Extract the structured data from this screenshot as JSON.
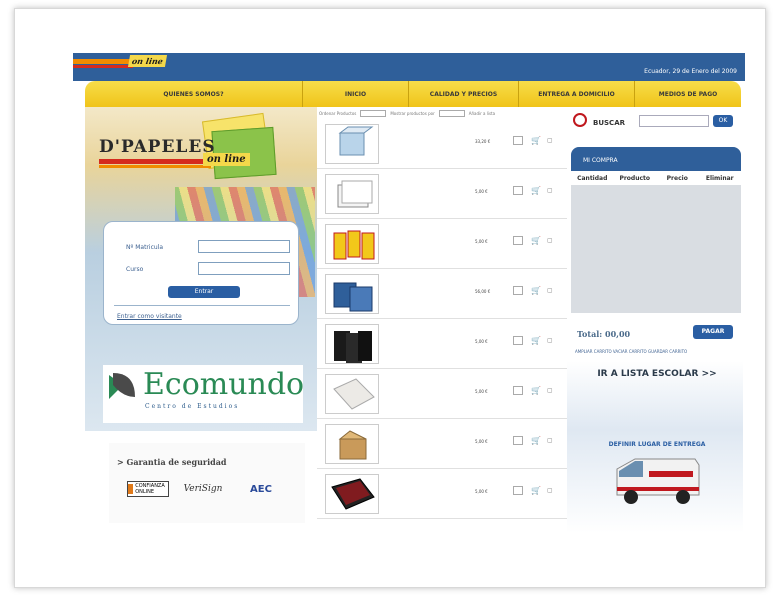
{
  "header": {
    "logo_text": "on line",
    "date": "Ecuador, 29 de Enero del 2009"
  },
  "nav": [
    "QUIENES SOMOS?",
    "INICIO",
    "CALIDAD Y PRECIOS",
    "ENTREGA A DOMICILIO",
    "MEDIOS DE PAGO"
  ],
  "brand": {
    "name": "D'PAPELES",
    "online": "on line"
  },
  "login": {
    "matricula_label": "Nº Matricula",
    "curso_label": "Curso",
    "enter_button": "Entrar",
    "visitor_link": "Entrar como visitante"
  },
  "ecomundo": {
    "name": "Ecomundo",
    "subtitle": "Centro de Estudios"
  },
  "security": {
    "title": "> Garantia de seguridad",
    "badges": [
      "CONFIANZA ONLINE",
      "VeriSign",
      "AEC"
    ]
  },
  "toolbar": {
    "sort": "Ordenar Productos",
    "show": "Mostrar productos por",
    "add": "Añadir a lista"
  },
  "products": [
    {
      "price": "33,20 €"
    },
    {
      "price": "5,00 €"
    },
    {
      "price": "5,00 €"
    },
    {
      "price": "56,00 €"
    },
    {
      "price": "5,00 €"
    },
    {
      "price": "5,00 €"
    },
    {
      "price": "5,00 €"
    },
    {
      "price": "5,00 €"
    }
  ],
  "search": {
    "label": "BUSCAR",
    "button": "OK"
  },
  "cart": {
    "title": "MI COMPRA",
    "columns": [
      "Cantidad",
      "Producto",
      "Precio",
      "Eliminar"
    ],
    "total": "Total: 00,00",
    "pay_button": "PAGAR",
    "links": "AMPLIAR CARRITO  VACIAR CARRITO  GUARDAR CARRITO"
  },
  "lista_escolar": "IR A LISTA ESCOLAR >>",
  "entrega": "DEFINIR LUGAR DE ENTREGA",
  "colors": {
    "blue": "#2f5f9a",
    "yellow": "#f0c419",
    "red": "#c0181e"
  }
}
